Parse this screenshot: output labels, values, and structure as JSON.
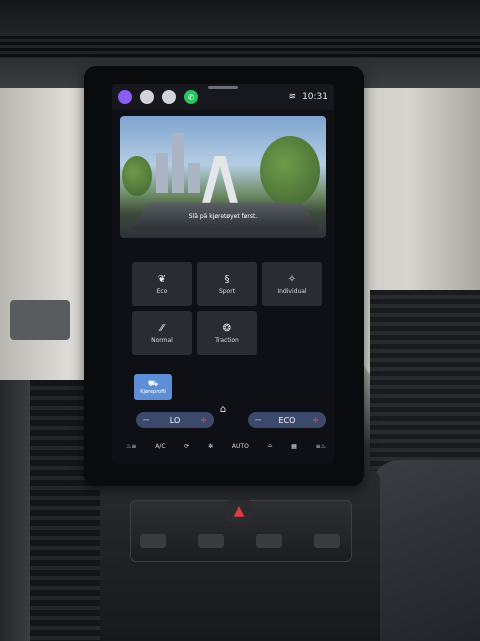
{
  "status_bar": {
    "app_icons": [
      {
        "name": "profile-app-icon",
        "color": "#8b5cf6"
      },
      {
        "name": "circle-app-icon-1",
        "color": "#d1d5db"
      },
      {
        "name": "circle-app-icon-2",
        "color": "#d1d5db"
      },
      {
        "name": "phone-app-icon",
        "color": "#22c55e"
      }
    ],
    "time": "10:31"
  },
  "hero": {
    "caption": "Slå på kjøretøyet først."
  },
  "drive_modes": [
    {
      "label": "Eco",
      "icon": "leaf-icon"
    },
    {
      "label": "Sport",
      "icon": "sport-icon"
    },
    {
      "label": "Individual",
      "icon": "individual-icon"
    },
    {
      "label": "Normal",
      "icon": "road-icon"
    },
    {
      "label": "Traction",
      "icon": "traction-icon"
    }
  ],
  "profile_button": {
    "label": "Kjøreprofil"
  },
  "climate": {
    "left_value": "LO",
    "right_value": "ECO"
  },
  "bottom_controls": {
    "ac": "A/C",
    "auto": "AUTO"
  }
}
